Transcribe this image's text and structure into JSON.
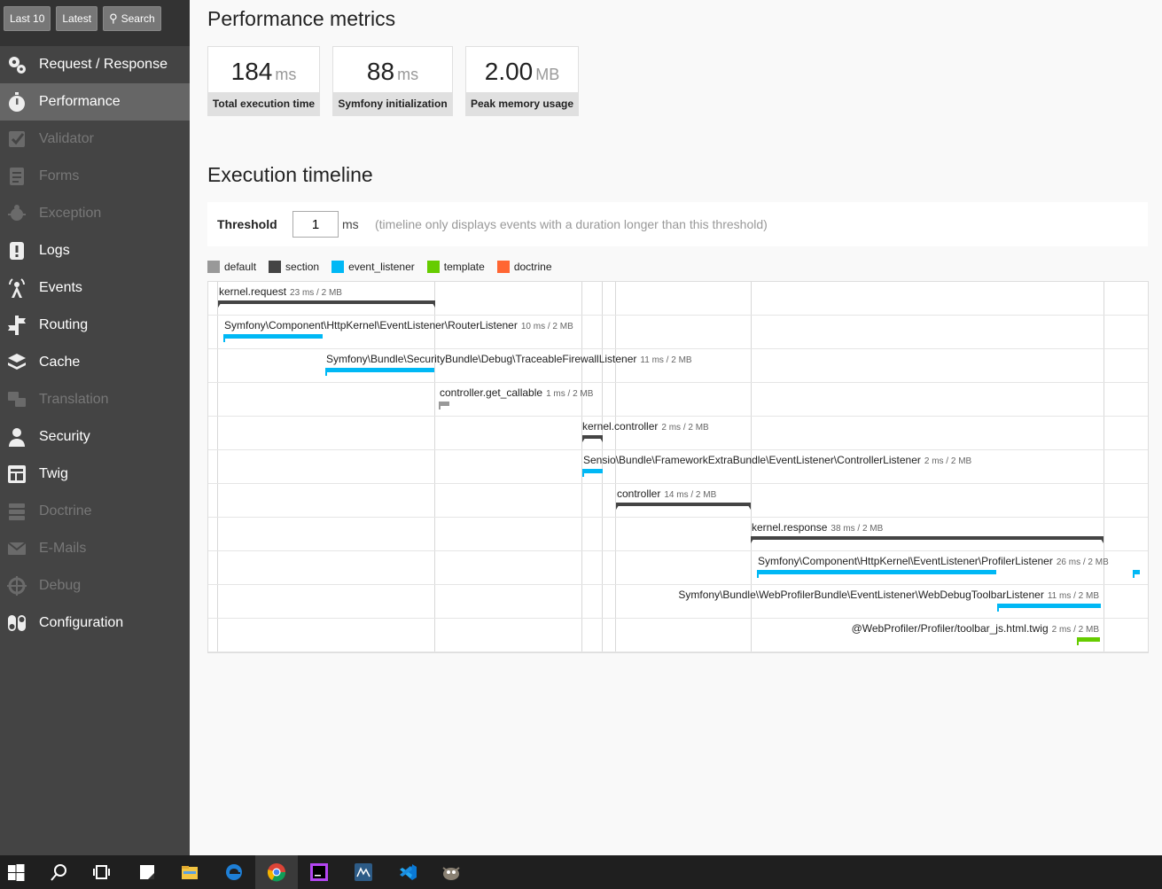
{
  "sidebar": {
    "top_buttons": [
      {
        "label": "Last 10"
      },
      {
        "label": "Latest"
      },
      {
        "label": "Search",
        "icon": "search-icon"
      }
    ],
    "items": [
      {
        "label": "Request / Response",
        "icon": "gears-icon",
        "state": "normal"
      },
      {
        "label": "Performance",
        "icon": "stopwatch-icon",
        "state": "active"
      },
      {
        "label": "Validator",
        "icon": "checkbox-icon",
        "state": "disabled"
      },
      {
        "label": "Forms",
        "icon": "form-icon",
        "state": "disabled"
      },
      {
        "label": "Exception",
        "icon": "bug-icon",
        "state": "disabled"
      },
      {
        "label": "Logs",
        "icon": "log-icon",
        "state": "normal"
      },
      {
        "label": "Events",
        "icon": "antenna-icon",
        "state": "normal"
      },
      {
        "label": "Routing",
        "icon": "signpost-icon",
        "state": "normal"
      },
      {
        "label": "Cache",
        "icon": "layers-icon",
        "state": "normal"
      },
      {
        "label": "Translation",
        "icon": "translate-icon",
        "state": "disabled"
      },
      {
        "label": "Security",
        "icon": "user-icon",
        "state": "normal"
      },
      {
        "label": "Twig",
        "icon": "template-icon",
        "state": "normal"
      },
      {
        "label": "Doctrine",
        "icon": "database-icon",
        "state": "disabled"
      },
      {
        "label": "E-Mails",
        "icon": "mail-icon",
        "state": "disabled"
      },
      {
        "label": "Debug",
        "icon": "crosshair-icon",
        "state": "disabled"
      },
      {
        "label": "Configuration",
        "icon": "toggles-icon",
        "state": "normal"
      }
    ]
  },
  "main": {
    "metrics_title": "Performance metrics",
    "metrics": [
      {
        "value": "184",
        "unit": "ms",
        "label": "Total execution time"
      },
      {
        "value": "88",
        "unit": "ms",
        "label": "Symfony initialization"
      },
      {
        "value": "2.00",
        "unit": "MB",
        "label": "Peak memory usage"
      }
    ],
    "timeline_title": "Execution timeline",
    "threshold": {
      "label": "Threshold",
      "value": "1",
      "unit": "ms",
      "help": "(timeline only displays events with a duration longer than this threshold)"
    },
    "legend": [
      {
        "label": "default",
        "color": "#999999"
      },
      {
        "label": "section",
        "color": "#444444"
      },
      {
        "label": "event_listener",
        "color": "#00b8f5"
      },
      {
        "label": "template",
        "color": "#66cc00"
      },
      {
        "label": "doctrine",
        "color": "#ff6633"
      }
    ],
    "events": [
      {
        "name": "kernel.request",
        "meta": "23 ms / 2 MB",
        "category": "section"
      },
      {
        "name": "Symfony\\Component\\HttpKernel\\EventListener\\RouterListener",
        "meta": "10 ms / 2 MB",
        "category": "event_listener"
      },
      {
        "name": "Symfony\\Bundle\\SecurityBundle\\Debug\\TraceableFirewallListener",
        "meta": "11 ms / 2 MB",
        "category": "event_listener"
      },
      {
        "name": "controller.get_callable",
        "meta": "1 ms / 2 MB",
        "category": "default"
      },
      {
        "name": "kernel.controller",
        "meta": "2 ms / 2 MB",
        "category": "section"
      },
      {
        "name": "Sensio\\Bundle\\FrameworkExtraBundle\\EventListener\\ControllerListener",
        "meta": "2 ms / 2 MB",
        "category": "event_listener"
      },
      {
        "name": "controller",
        "meta": "14 ms / 2 MB",
        "category": "section"
      },
      {
        "name": "kernel.response",
        "meta": "38 ms / 2 MB",
        "category": "section"
      },
      {
        "name": "Symfony\\Component\\HttpKernel\\EventListener\\ProfilerListener",
        "meta": "26 ms / 2 MB",
        "category": "event_listener"
      },
      {
        "name": "Symfony\\Bundle\\WebProfilerBundle\\EventListener\\WebDebugToolbarListener",
        "meta": "11 ms / 2 MB",
        "category": "event_listener"
      },
      {
        "name": "@WebProfiler/Profiler/toolbar_js.html.twig",
        "meta": "2 ms / 2 MB",
        "category": "template"
      }
    ]
  },
  "taskbar": {
    "icons": [
      "windows-start-icon",
      "search-icon",
      "task-view-icon",
      "sticky-notes-icon",
      "file-explorer-icon",
      "edge-icon",
      "chrome-icon",
      "phpstorm-icon",
      "mysql-workbench-icon",
      "vscode-icon",
      "gimp-icon"
    ]
  }
}
